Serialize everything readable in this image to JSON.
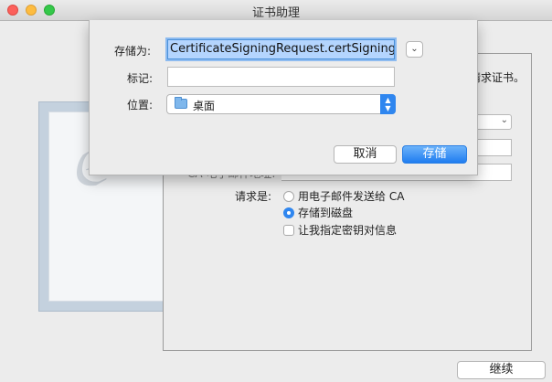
{
  "window": {
    "title": "证书助理"
  },
  "background": {
    "hint_text": "请求证书。",
    "ca_email_label": "CA 电子邮件地址:",
    "request_label": "请求是:",
    "options": [
      {
        "label": "用电子邮件发送给 CA",
        "selected": false
      },
      {
        "label": "存储到磁盘",
        "selected": true
      }
    ],
    "checkbox_label": "让我指定密钥对信息",
    "continue_label": "继续"
  },
  "save_sheet": {
    "save_as_label": "存储为:",
    "save_as_value": "CertificateSigningRequest.certSigningRe",
    "tags_label": "标记:",
    "tags_value": "",
    "where_label": "位置:",
    "where_value": "桌面",
    "cancel_label": "取消",
    "save_label": "存储"
  },
  "colors": {
    "accent": "#2f86ef",
    "selection": "#b4d5fe"
  }
}
